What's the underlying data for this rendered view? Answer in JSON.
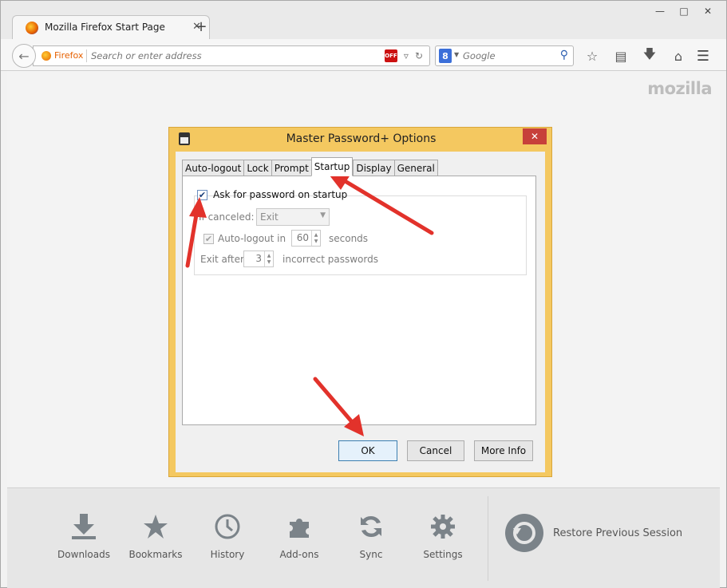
{
  "browser": {
    "tab_title": "Mozilla Firefox Start Page",
    "identity_label": "Firefox",
    "url_placeholder": "Search or enter address",
    "search_engine_letter": "8",
    "search_placeholder": "Google",
    "off_badge": "OFF"
  },
  "page": {
    "logo_text": "mozilla"
  },
  "launcher": {
    "items": [
      {
        "label": "Downloads",
        "icon": "download-icon"
      },
      {
        "label": "Bookmarks",
        "icon": "star-icon"
      },
      {
        "label": "History",
        "icon": "clock-icon"
      },
      {
        "label": "Add-ons",
        "icon": "puzzle-icon"
      },
      {
        "label": "Sync",
        "icon": "sync-icon"
      },
      {
        "label": "Settings",
        "icon": "gear-icon"
      }
    ],
    "restore_label": "Restore Previous Session"
  },
  "dialog": {
    "title": "Master Password+ Options",
    "tabs": [
      "Auto-logout",
      "Lock",
      "Prompt",
      "Startup",
      "Display",
      "General"
    ],
    "active_tab": "Startup",
    "ask_on_startup_label": "Ask for password on startup",
    "ask_on_startup_checked": true,
    "if_canceled_label": "If canceled:",
    "if_canceled_value": "Exit",
    "autologout_label": "Auto-logout in",
    "autologout_checked": true,
    "autologout_value": "60",
    "autologout_unit": "seconds",
    "exit_after_label": "Exit after",
    "exit_after_value": "3",
    "exit_after_unit": "incorrect passwords",
    "buttons": {
      "ok": "OK",
      "cancel": "Cancel",
      "more_info": "More Info"
    }
  },
  "colors": {
    "dialog_frame": "#f4c860",
    "close_button": "#c7403a",
    "annotation_arrow": "#e2322b",
    "firefox_orange": "#e66000"
  }
}
